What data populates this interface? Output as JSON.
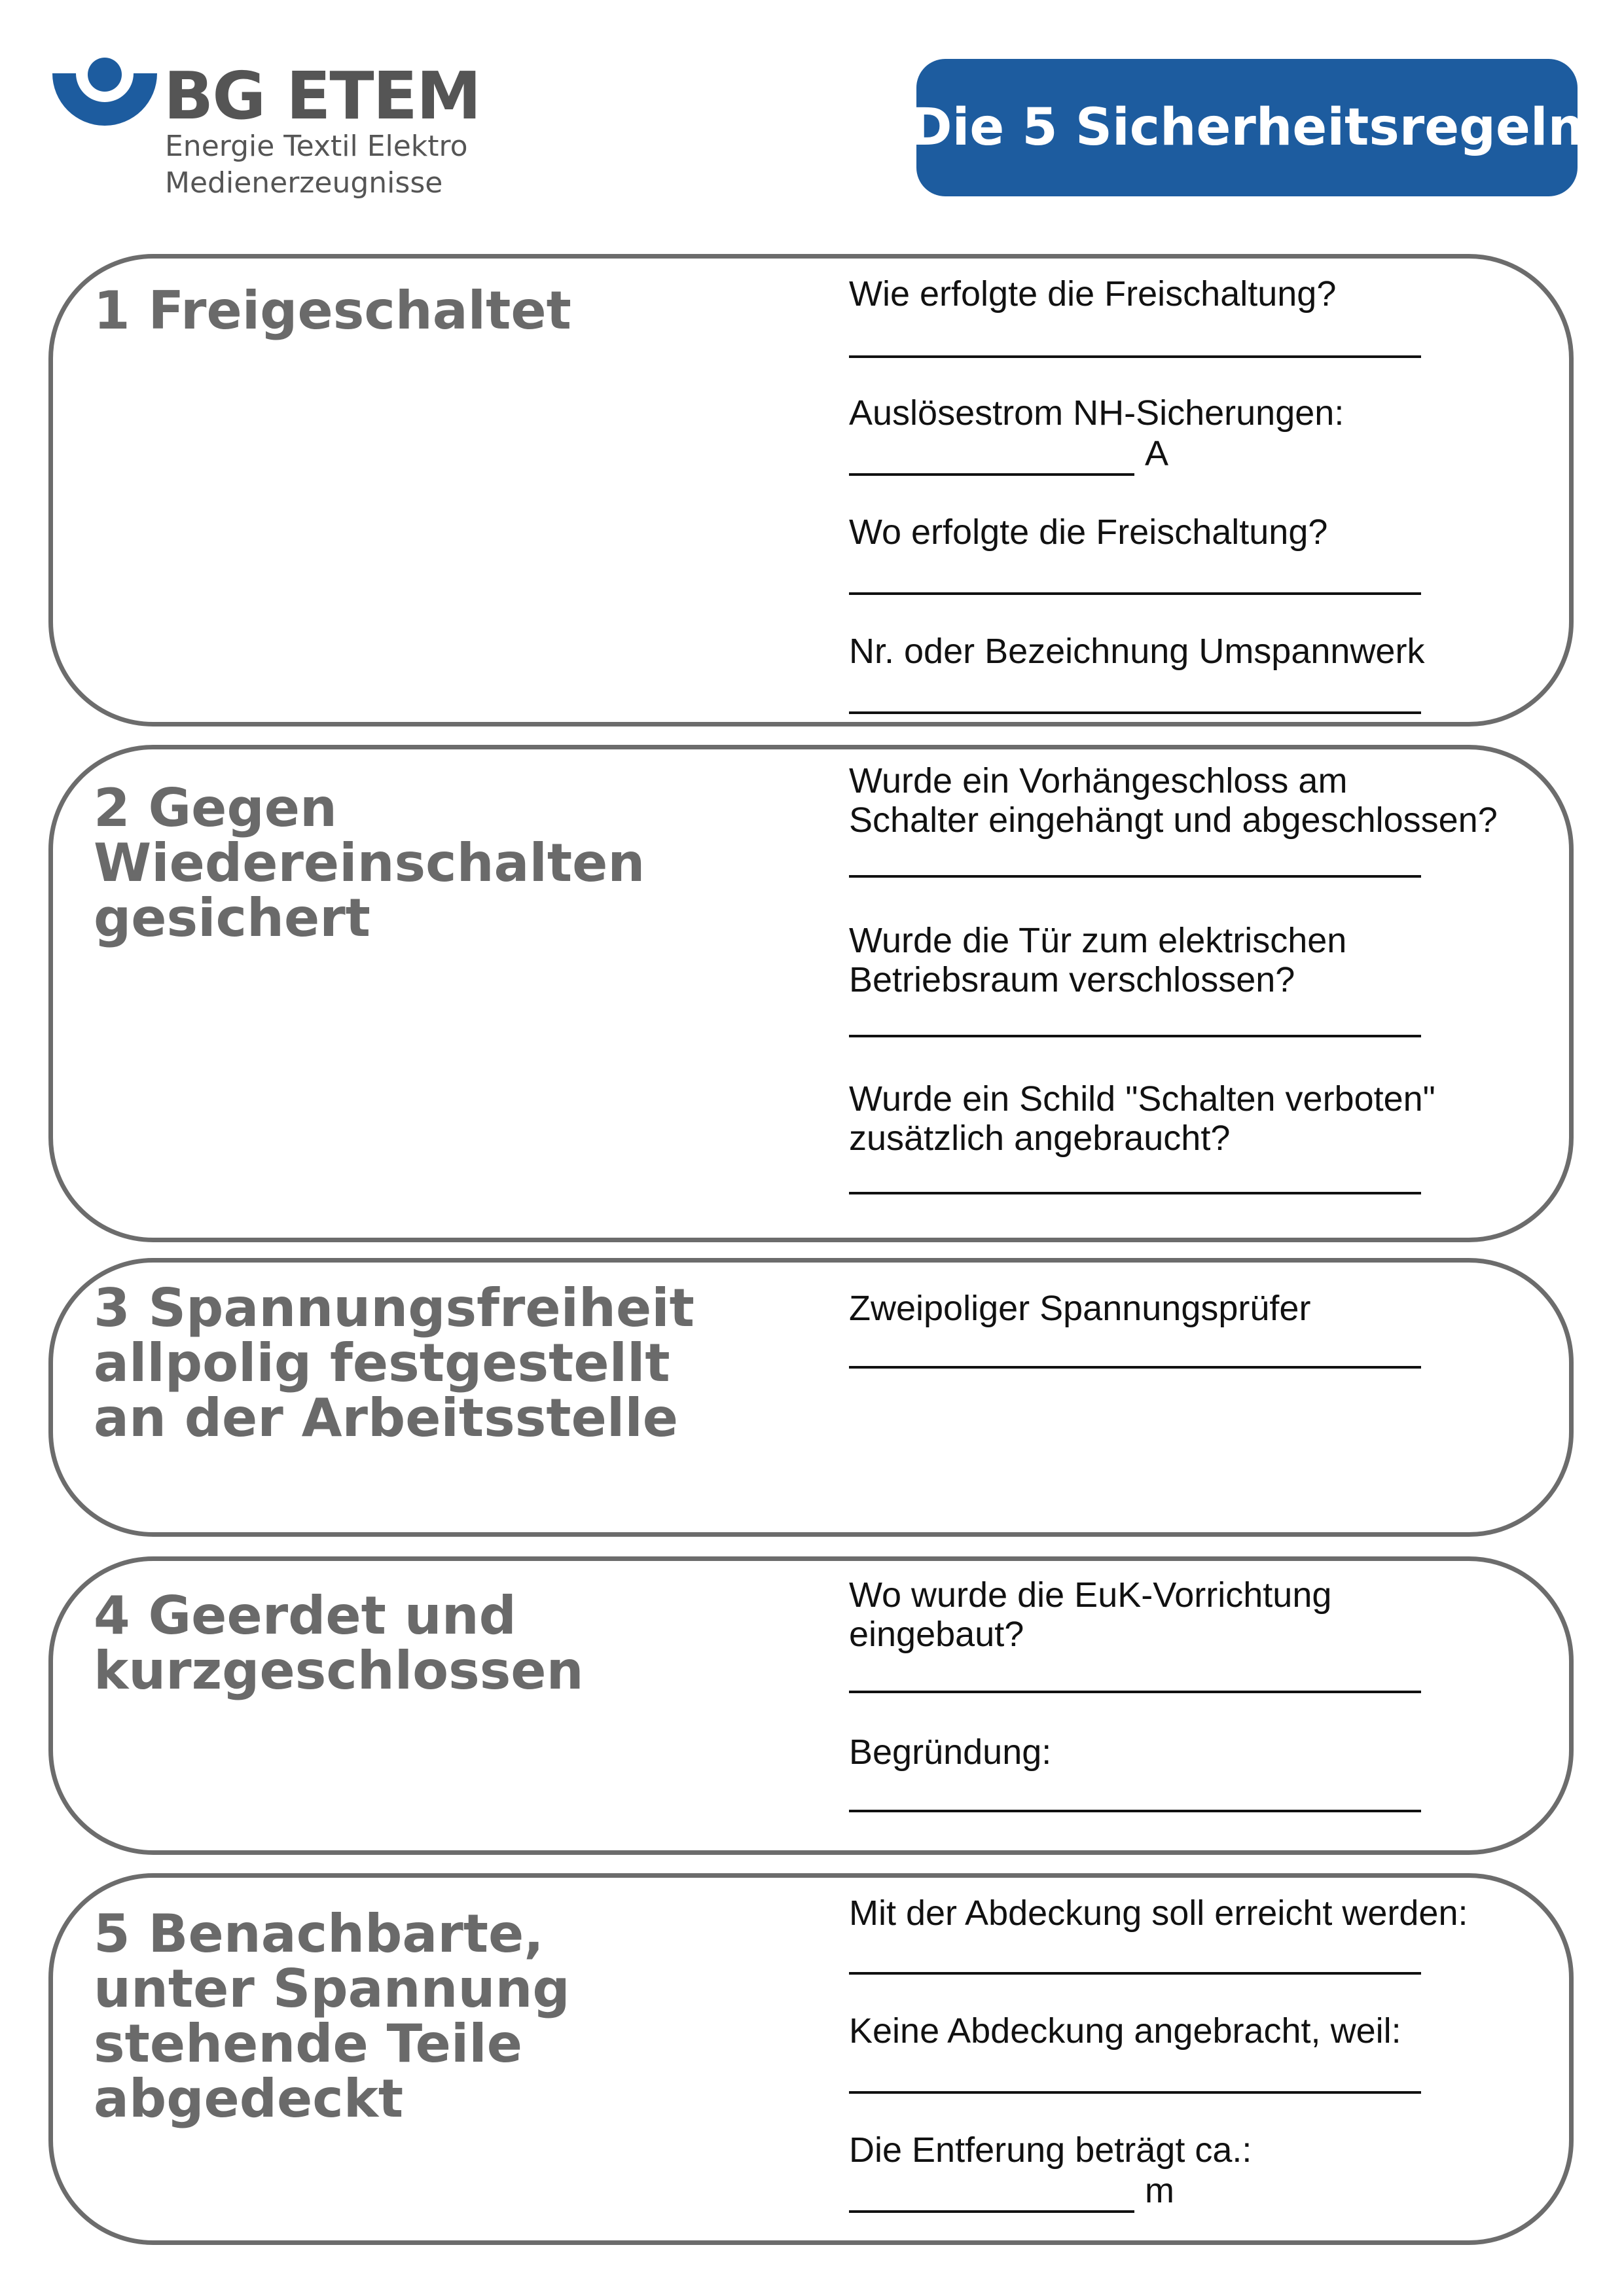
{
  "logo": {
    "name": "BG ETEM",
    "line1": "Energie Textil Elektro",
    "line2": "Medienerzeugnisse",
    "color": "#1d5c9f"
  },
  "title": "Die 5 Sicherheitsregeln",
  "rules": [
    {
      "title_lines": [
        "1 Freigeschaltet"
      ],
      "questions": [
        {
          "text_lines": [
            "Wie erfolgte die Freischaltung?"
          ]
        },
        {
          "text_lines": [
            "Auslösestrom NH-Sicherungen:"
          ],
          "unit": "A"
        },
        {
          "text_lines": [
            "Wo erfolgte die Freischaltung?"
          ]
        },
        {
          "text_lines": [
            "Nr. oder Bezeichnung Umspannwerk"
          ]
        }
      ]
    },
    {
      "title_lines": [
        "2 Gegen",
        "Wiedereinschalten",
        "gesichert"
      ],
      "questions": [
        {
          "text_lines": [
            "Wurde ein Vorhängeschloss am",
            "Schalter eingehängt und abgeschlossen?"
          ]
        },
        {
          "text_lines": [
            "Wurde die Tür zum elektrischen",
            "Betriebsraum verschlossen?"
          ]
        },
        {
          "text_lines": [
            "Wurde ein Schild \"Schalten verboten\"",
            "zusätzlich angebraucht?"
          ]
        }
      ]
    },
    {
      "title_lines": [
        "3 Spannungsfreiheit",
        "allpolig festgestellt",
        "an der Arbeitsstelle"
      ],
      "questions": [
        {
          "text_lines": [
            "Zweipoliger Spannungsprüfer"
          ]
        }
      ]
    },
    {
      "title_lines": [
        "4 Geerdet und",
        "kurzgeschlossen"
      ],
      "questions": [
        {
          "text_lines": [
            "Wo wurde die EuK-Vorrichtung",
            "eingebaut?"
          ]
        },
        {
          "text_lines": [
            "Begründung:"
          ]
        }
      ]
    },
    {
      "title_lines": [
        "5 Benachbarte,",
        "unter Spannung",
        "stehende Teile",
        "abgedeckt"
      ],
      "questions": [
        {
          "text_lines": [
            "Mit der Abdeckung soll erreicht werden:"
          ]
        },
        {
          "text_lines": [
            "Keine Abdeckung angebracht, weil:"
          ]
        },
        {
          "text_lines": [
            "Die Entferung beträgt ca.:"
          ],
          "unit": "m"
        }
      ]
    }
  ]
}
